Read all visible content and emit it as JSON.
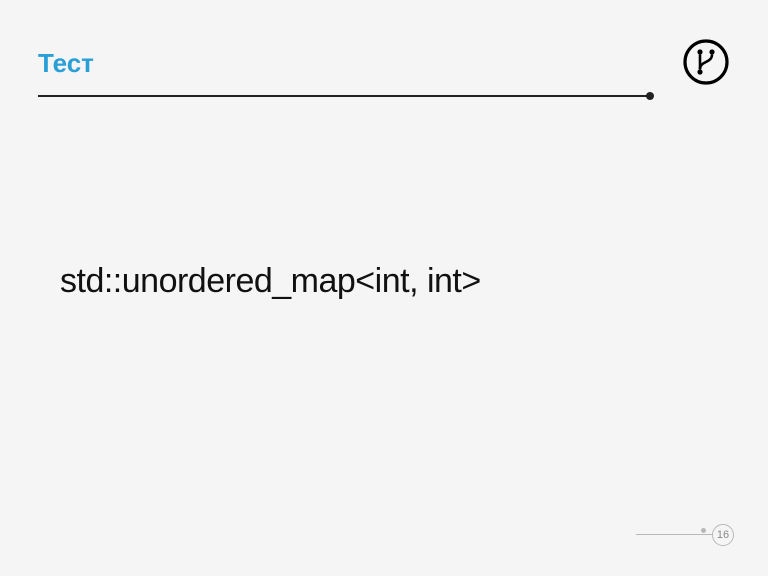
{
  "title": "Тест",
  "body_text": "std::unordered_map<int, int>",
  "page_number": "16",
  "icon_name": "git-branch-icon"
}
